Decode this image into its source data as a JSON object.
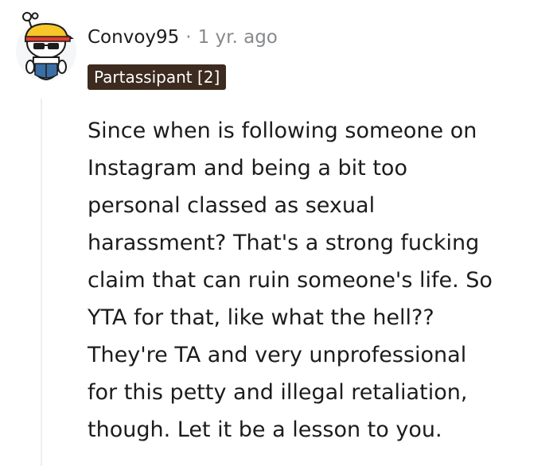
{
  "comment": {
    "author": "Convoy95",
    "separator": "·",
    "timestamp": "1 yr. ago",
    "flair": "Partassipant [2]",
    "body_lines": [
      "Since when is following someone on",
      "Instagram and being a bit too",
      "personal classed as sexual",
      "harassment? That's a strong fucking",
      "claim that can ruin someone's life. So",
      "YTA for that, like what the hell??",
      "They're TA and very unprofessional",
      "for this petty and illegal retaliation,",
      "though. Let it be a lesson to you."
    ]
  },
  "colors": {
    "text": "#1c1c1c",
    "meta": "#878a8c",
    "flair_bg": "#3d2b1f",
    "flair_text": "#ffffff",
    "thread_line": "#edeff1",
    "avatar_hat": "#f7c72a",
    "avatar_band": "#e23d2d",
    "avatar_shirt": "#3a6ea5"
  },
  "icons": {
    "avatar": "snoo-avatar-icon"
  }
}
